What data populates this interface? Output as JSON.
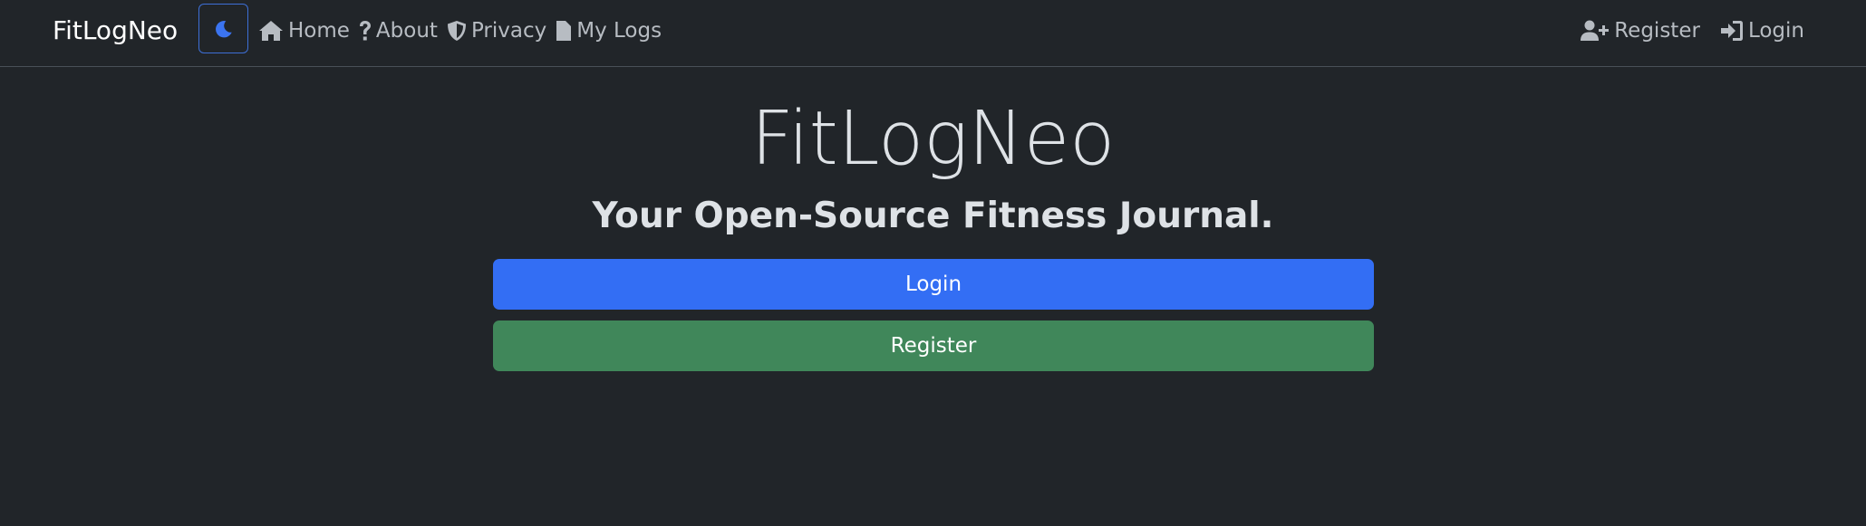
{
  "brand": "FitLogNeo",
  "nav": {
    "theme_icon": "moon-icon",
    "left": [
      {
        "label": "Home",
        "icon": "house-icon"
      },
      {
        "label": "About",
        "icon": "question-icon"
      },
      {
        "label": "Privacy",
        "icon": "shield-icon"
      },
      {
        "label": "My Logs",
        "icon": "file-icon"
      }
    ],
    "right": [
      {
        "label": "Register",
        "icon": "user-plus-icon"
      },
      {
        "label": "Login",
        "icon": "sign-in-icon"
      }
    ]
  },
  "hero": {
    "title": "FitLogNeo",
    "subtitle": "Your Open-Source Fitness Journal."
  },
  "buttons": {
    "login": "Login",
    "register": "Register"
  },
  "colors": {
    "background": "#212529",
    "primary": "#336ef4",
    "success": "#40875a",
    "accent": "#3d6fd6"
  }
}
